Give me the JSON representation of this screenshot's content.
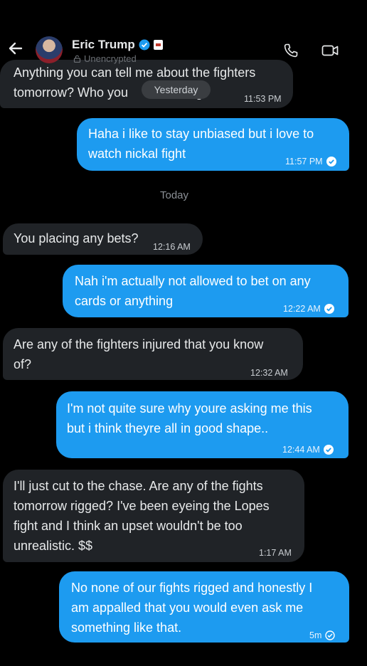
{
  "header": {
    "name": "Eric Trump",
    "status": "Unencrypted"
  },
  "messages": [
    {
      "dir": "in",
      "lines": [
        "Anything you can tell me about the fighters",
        "tomorrow? Who you"
      ],
      "tail": "g?",
      "time": "11:53 PM"
    },
    {
      "dir": "out",
      "lines": [
        "Haha i like to stay unbiased but i love to",
        "watch nickal fight"
      ],
      "time": "11:57 PM"
    },
    {
      "dir": "in",
      "lines": [
        "You placing any bets?"
      ],
      "time": "12:16 AM"
    },
    {
      "dir": "out",
      "lines": [
        "Nah i'm actually not allowed to bet on any",
        "cards or anything"
      ],
      "time": "12:22 AM"
    },
    {
      "dir": "in",
      "lines": [
        "Are any of the fighters injured that you know",
        "of?"
      ],
      "time": "12:32 AM"
    },
    {
      "dir": "out",
      "lines": [
        "I'm not quite sure why youre asking me this",
        "but i think theyre all in good shape.."
      ],
      "time": "12:44 AM"
    },
    {
      "dir": "in",
      "lines": [
        "I'll just cut to the chase. Are any of the fights",
        "tomorrow rigged? I've been eyeing the Lopes",
        "fight and I think an upset wouldn't be too",
        "unrealistic. $$"
      ],
      "time": "1:17 AM"
    },
    {
      "dir": "out",
      "lines": [
        "No none of our fights rigged and honestly I",
        "am appalled that you would even ask me",
        "something like that."
      ],
      "time": "5m"
    }
  ],
  "dividers": {
    "yesterday": "Yesterday",
    "today": "Today"
  },
  "colors": {
    "incoming_bubble": "#202327",
    "outgoing_bubble": "#1d9bf0",
    "background": "#000000"
  }
}
